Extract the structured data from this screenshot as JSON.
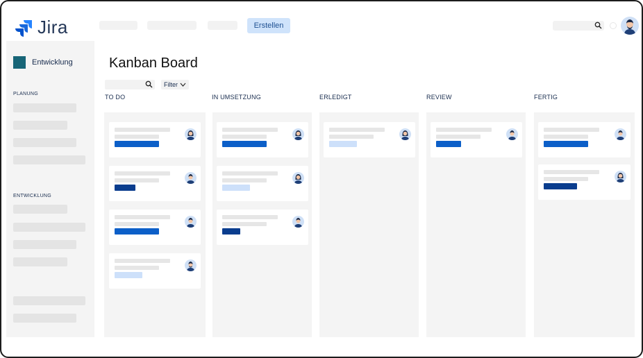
{
  "app": {
    "name": "Jira",
    "brand_color": "#2684FF"
  },
  "header": {
    "create_label": "Erstellen",
    "search_icon": "search-icon"
  },
  "sidebar": {
    "project_name": "Entwicklung",
    "sections": [
      {
        "label": "PLANUNG"
      },
      {
        "label": "ENTWICKLUNG"
      }
    ]
  },
  "board": {
    "title": "Kanban Board",
    "filter_label": "Filter",
    "columns": [
      {
        "title": "TO DO",
        "cards": [
          {
            "tag": "blue",
            "avatar": "woman-avatar-icon"
          },
          {
            "tag": "navy",
            "avatar": "man-avatar-icon"
          },
          {
            "tag": "blue",
            "avatar": "man-avatar-icon"
          },
          {
            "tag": "light",
            "avatar": "bearded-man-avatar-icon"
          }
        ]
      },
      {
        "title": "IN UMSETZUNG",
        "cards": [
          {
            "tag": "blue",
            "avatar": "woman-avatar-icon"
          },
          {
            "tag": "light",
            "avatar": "woman-avatar-icon"
          },
          {
            "tag": "navy",
            "avatar": "man-avatar-icon"
          }
        ]
      },
      {
        "title": "ERLEDIGT",
        "cards": [
          {
            "tag": "light",
            "avatar": "woman-avatar-icon"
          }
        ]
      },
      {
        "title": "REVIEW",
        "cards": [
          {
            "tag": "blue",
            "avatar": "man-avatar-icon"
          }
        ]
      },
      {
        "title": "FERTIG",
        "cards": [
          {
            "tag": "blue",
            "avatar": "man-avatar-icon"
          },
          {
            "tag": "navy",
            "avatar": "woman-avatar-icon"
          }
        ]
      }
    ]
  }
}
